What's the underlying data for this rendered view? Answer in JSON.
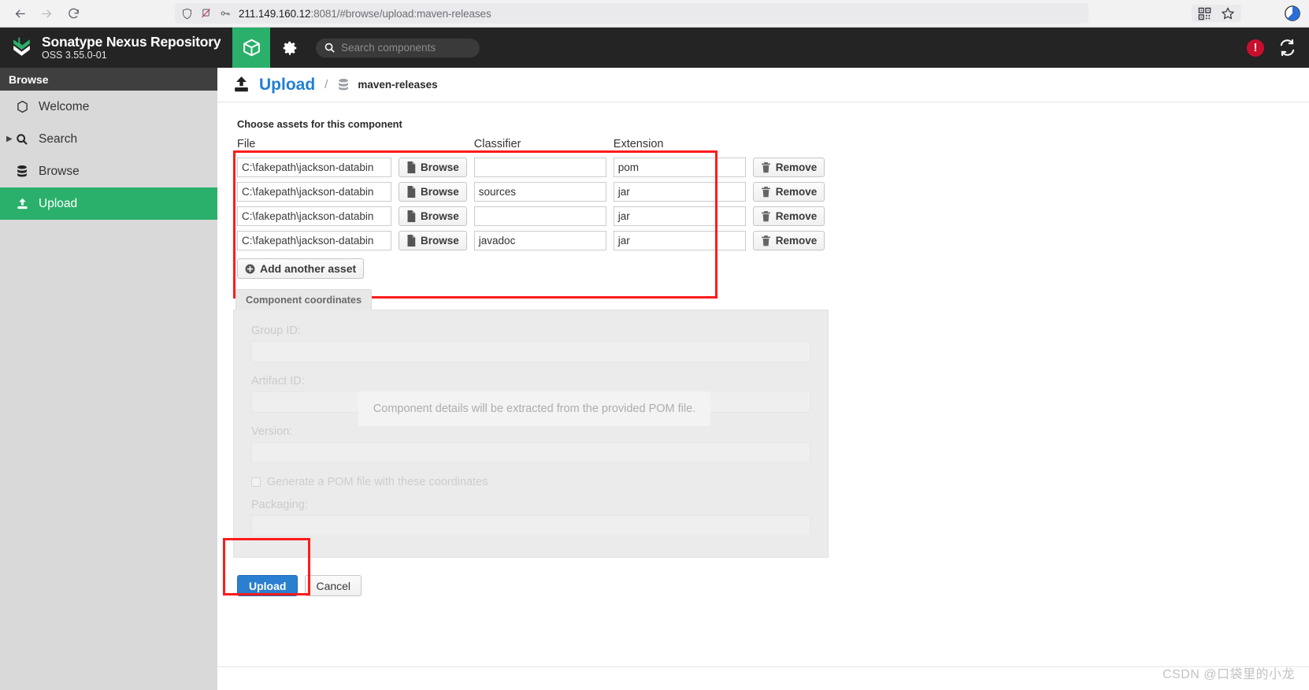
{
  "browser": {
    "back_icon": "arrow-left-icon",
    "forward_icon": "arrow-right-icon",
    "reload_icon": "reload-icon",
    "shield_icon": "shield-icon",
    "permissions_icon": "camera-blocked-icon",
    "key_icon": "key-icon",
    "url_host": "211.149.160.12",
    "url_rest": ":8081/#browse/upload:maven-releases",
    "qr_icon": "qr-code-icon",
    "bookmark_icon": "star-icon",
    "profile_icon": "account-circle-icon"
  },
  "header": {
    "logo_icon": "nexus-logo-icon",
    "brand_title": "Sonatype Nexus Repository",
    "brand_subtitle": "OSS 3.55.0-01",
    "browse_tab_icon": "cube-icon",
    "admin_tab_icon": "gear-icon",
    "search_icon": "search-icon",
    "search_placeholder": "Search components",
    "search_value": "",
    "alert_icon": "alert-exclamation-icon",
    "refresh_icon": "refresh-sync-icon",
    "accent_green": "#2ab06a",
    "alert_red": "#c8102e"
  },
  "sidebar": {
    "title": "Browse",
    "items": [
      {
        "label": "Welcome",
        "icon": "hexagon-icon",
        "expandable": false,
        "active": false
      },
      {
        "label": "Search",
        "icon": "search-icon",
        "expandable": true,
        "active": false
      },
      {
        "label": "Browse",
        "icon": "database-icon",
        "expandable": false,
        "active": false
      },
      {
        "label": "Upload",
        "icon": "upload-icon",
        "expandable": false,
        "active": true
      }
    ]
  },
  "page": {
    "icon": "upload-icon",
    "title": "Upload",
    "separator": "/",
    "repo_icon": "database-icon",
    "repository": "maven-releases"
  },
  "assets": {
    "section_label": "Choose assets for this component",
    "columns": [
      "File",
      "Classifier",
      "Extension"
    ],
    "rows": [
      {
        "file": "C:\\fakepath\\jackson-databin",
        "browse_label": "Browse",
        "classifier": "",
        "extension": "pom",
        "remove_label": "Remove"
      },
      {
        "file": "C:\\fakepath\\jackson-databin",
        "browse_label": "Browse",
        "classifier": "sources",
        "extension": "jar",
        "remove_label": "Remove"
      },
      {
        "file": "C:\\fakepath\\jackson-databin",
        "browse_label": "Browse",
        "classifier": "",
        "extension": "jar",
        "remove_label": "Remove"
      },
      {
        "file": "C:\\fakepath\\jackson-databin",
        "browse_label": "Browse",
        "classifier": "javadoc",
        "extension": "jar",
        "remove_label": "Remove"
      }
    ],
    "add_another_label": "Add another asset",
    "add_icon": "plus-circle-icon",
    "browse_icon": "file-icon",
    "remove_icon": "trash-icon"
  },
  "coordinates": {
    "tab_label": "Component coordinates",
    "group_id_label": "Group ID:",
    "group_id_value": "",
    "artifact_id_label": "Artifact ID:",
    "artifact_id_value": "",
    "version_label": "Version:",
    "version_value": "",
    "generate_pom_label": "Generate a POM file with these coordinates",
    "generate_pom_checked": false,
    "packaging_label": "Packaging:",
    "packaging_value": "",
    "overlay_message": "Component details will be extracted from the provided POM file."
  },
  "actions": {
    "upload_label": "Upload",
    "cancel_label": "Cancel",
    "upload_color": "#2b7fd0"
  },
  "annotations": {
    "highlight_color": "#ff1c1c"
  },
  "watermark": "CSDN @口袋里的小龙"
}
